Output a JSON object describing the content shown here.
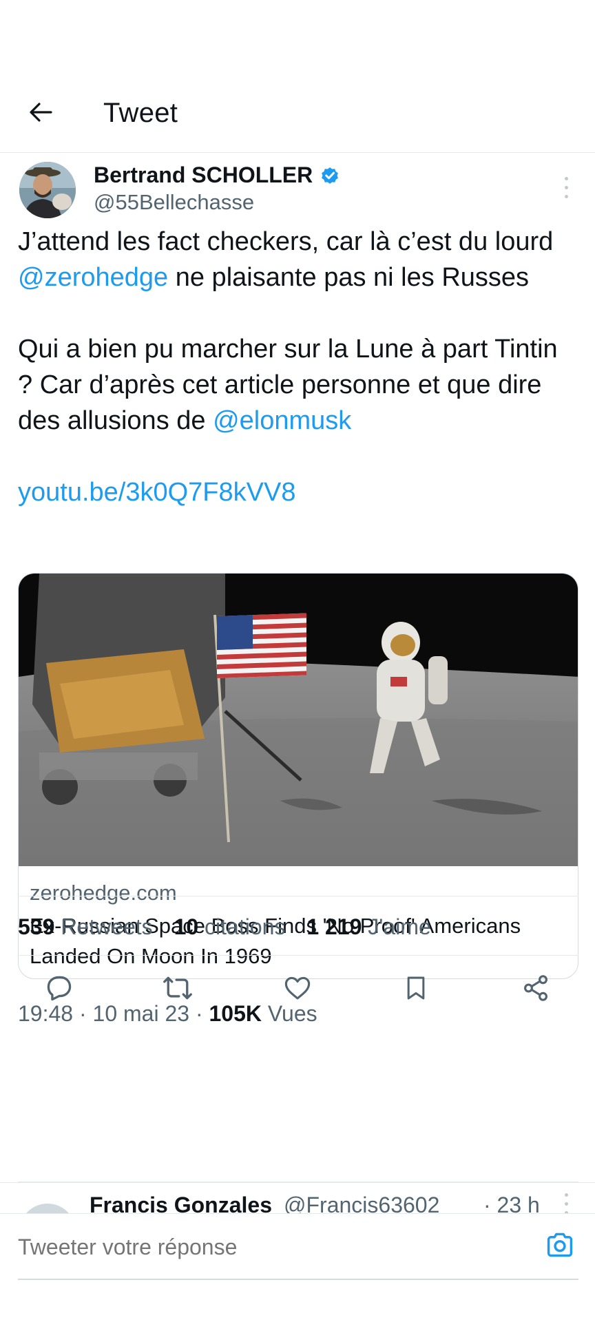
{
  "header": {
    "title": "Tweet",
    "back_icon": "arrow-left-icon"
  },
  "tweet": {
    "author_name": "Bertrand SCHOLLER",
    "author_handle": "@55Bellechasse",
    "verified_icon": "verified-badge-icon",
    "body": {
      "line1_a": "J’attend les fact checkers, car là c’est du lourd ",
      "mention1": "@zerohedge",
      "line1_b": " ne plaisante pas ni les Russes",
      "line2_a": "Qui a bien pu marcher sur la Lune à part Tintin ? Car d’après cet article personne et que dire des allusions de ",
      "mention2": "@elonmusk",
      "link": "youtu.be/3k0Q7F8kVV8"
    },
    "card": {
      "domain": "zerohedge.com",
      "title": "Ex-Russian Space Boss Finds 'No Proof' Americans Landed On Moon In 1969"
    },
    "meta": {
      "time": "19:48",
      "date": "10 mai 23",
      "views_count": "105K",
      "views_label": "Vues"
    },
    "stats": {
      "retweets_count": "539",
      "retweets_label": "Retweets",
      "quotes_count": "10",
      "quotes_label": "citations",
      "likes_count": "1 219",
      "likes_label": "J'aime"
    }
  },
  "reply_preview": {
    "name": "Francis Gonzales",
    "handle": "@Francis63602",
    "time": "· 23 h"
  },
  "composer": {
    "placeholder": "Tweeter votre réponse"
  },
  "colors": {
    "accent": "#1d9bf0",
    "text": "#0f1419",
    "secondary": "#536471",
    "divider": "#e6e9ec"
  }
}
